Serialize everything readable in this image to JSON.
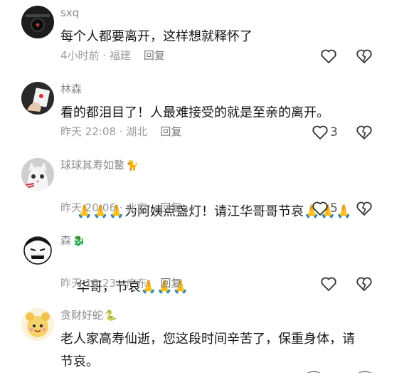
{
  "comments": [
    {
      "username": "sxq",
      "username_tag": "",
      "text": "每个人都要离开，这样想就释怀了",
      "time": "4小时前 · 福建",
      "reply_label": "回复",
      "likes": "",
      "avatar": "dark-album-cover"
    },
    {
      "username": "林森",
      "username_tag": "",
      "text": "看的都泪目了！人最难接受的就是至亲的离开。",
      "time": "昨天 22:08 · 湖北",
      "reply_label": "回复",
      "likes": "3",
      "avatar": "hand-with-cards"
    },
    {
      "username": "球球其寿如鳌",
      "username_tag": "🐈",
      "text_prefix": "🙏🙏🙏",
      "text": "为阿姨点盏灯！请江华哥哥节哀",
      "text_suffix": "🙏🙏🙏",
      "time": "昨天 20:06 · 北京",
      "reply_label": "回复",
      "likes": "5",
      "avatar": "cat-face"
    },
    {
      "username": "森",
      "username_tag": "🐉",
      "text": "华哥，节哀",
      "text_suffix": "🙏🙏🙏",
      "time": "昨天 18:23 · 广东",
      "reply_label": "回复",
      "likes": "",
      "avatar": "meme-face"
    },
    {
      "username": "贪财好蛇",
      "username_tag": "🐍",
      "text": "老人家高寿仙逝，您这段时间辛苦了，保重身体，请节哀。",
      "time": "",
      "reply_label": "",
      "likes": "",
      "avatar": "golden-cartoon"
    }
  ],
  "icons": {
    "like": "heart-outline-icon",
    "dislike": "broken-heart-icon"
  }
}
